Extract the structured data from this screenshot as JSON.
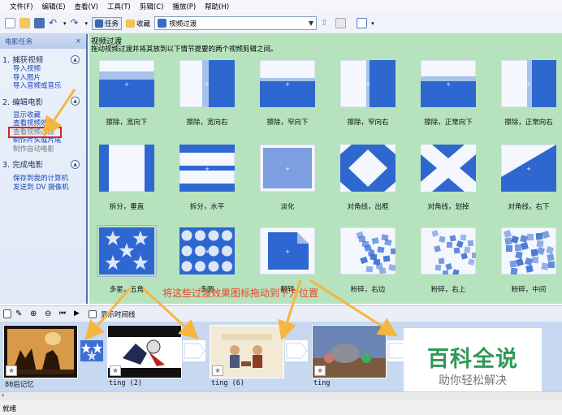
{
  "menu": [
    "文件(F)",
    "编辑(E)",
    "查看(V)",
    "工具(T)",
    "剪辑(C)",
    "播放(P)",
    "帮助(H)"
  ],
  "toolbar": {
    "task_label": "任务",
    "collection_label": "收藏",
    "collection_value": "视频过渡"
  },
  "taskpane": {
    "header": "电影任务",
    "close": "×",
    "sections": [
      {
        "title": "1. 捕获视频",
        "links": [
          "导入视频",
          "导入图片",
          "导入音频或音乐"
        ]
      },
      {
        "title": "2. 编辑电影",
        "links": [
          "显示收藏",
          "查看视频效果",
          "查看视频过渡",
          "制作片头或片尾",
          "制作自动电影"
        ]
      },
      {
        "title": "3. 完成电影",
        "links": [
          "保存到我的计算机",
          "发送到 DV 摄像机"
        ]
      }
    ]
  },
  "pane": {
    "title": "视频过渡",
    "description": "拖动视频过渡并将其放到以下情节提要的两个视频剪辑之间。"
  },
  "transitions": [
    {
      "label": "擦除，宽向下",
      "type": "wipe-wide-down"
    },
    {
      "label": "擦除，宽向右",
      "type": "wipe-wide-right"
    },
    {
      "label": "擦除，窄向下",
      "type": "wipe-narrow-down"
    },
    {
      "label": "擦除，窄向右",
      "type": "wipe-narrow-right"
    },
    {
      "label": "擦除，正常向下",
      "type": "wipe-normal-down"
    },
    {
      "label": "擦除，正常向右",
      "type": "wipe-normal-right"
    },
    {
      "label": "拆分，垂直",
      "type": "split-vertical"
    },
    {
      "label": "拆分，水平",
      "type": "split-horizontal"
    },
    {
      "label": "淡化",
      "type": "fade"
    },
    {
      "label": "对角线，出框",
      "type": "diag-box"
    },
    {
      "label": "对角线，划掉",
      "type": "diag-cross"
    },
    {
      "label": "对角线，右下",
      "type": "diag-down-right"
    },
    {
      "label": "多星，五角",
      "type": "stars"
    },
    {
      "label": "多圆",
      "type": "circles"
    },
    {
      "label": "翻转",
      "type": "flip"
    },
    {
      "label": "粉碎，右边",
      "type": "shatter-right"
    },
    {
      "label": "粉碎，右上",
      "type": "shatter-upper-right"
    },
    {
      "label": "粉碎，中间",
      "type": "shatter-center"
    }
  ],
  "annotation": "将这些过渡效果图标拖动到下方位置",
  "storyboard_toolbar": {
    "timeline_label": "显示时间线"
  },
  "clips": [
    {
      "label": "80后记忆"
    },
    {
      "label": "ting (2)"
    },
    {
      "label": "ting (6)"
    },
    {
      "label": "ting"
    }
  ],
  "watermark": {
    "title": "百科全说",
    "subtitle": "助你轻松解决"
  },
  "status": "就绪",
  "colors": {
    "accent": "#3f6ec9",
    "pane_bg": "#b6e3bd",
    "annotation": "#e8452a",
    "arrow": "#f5b640",
    "highlight_box": "#e02020"
  }
}
